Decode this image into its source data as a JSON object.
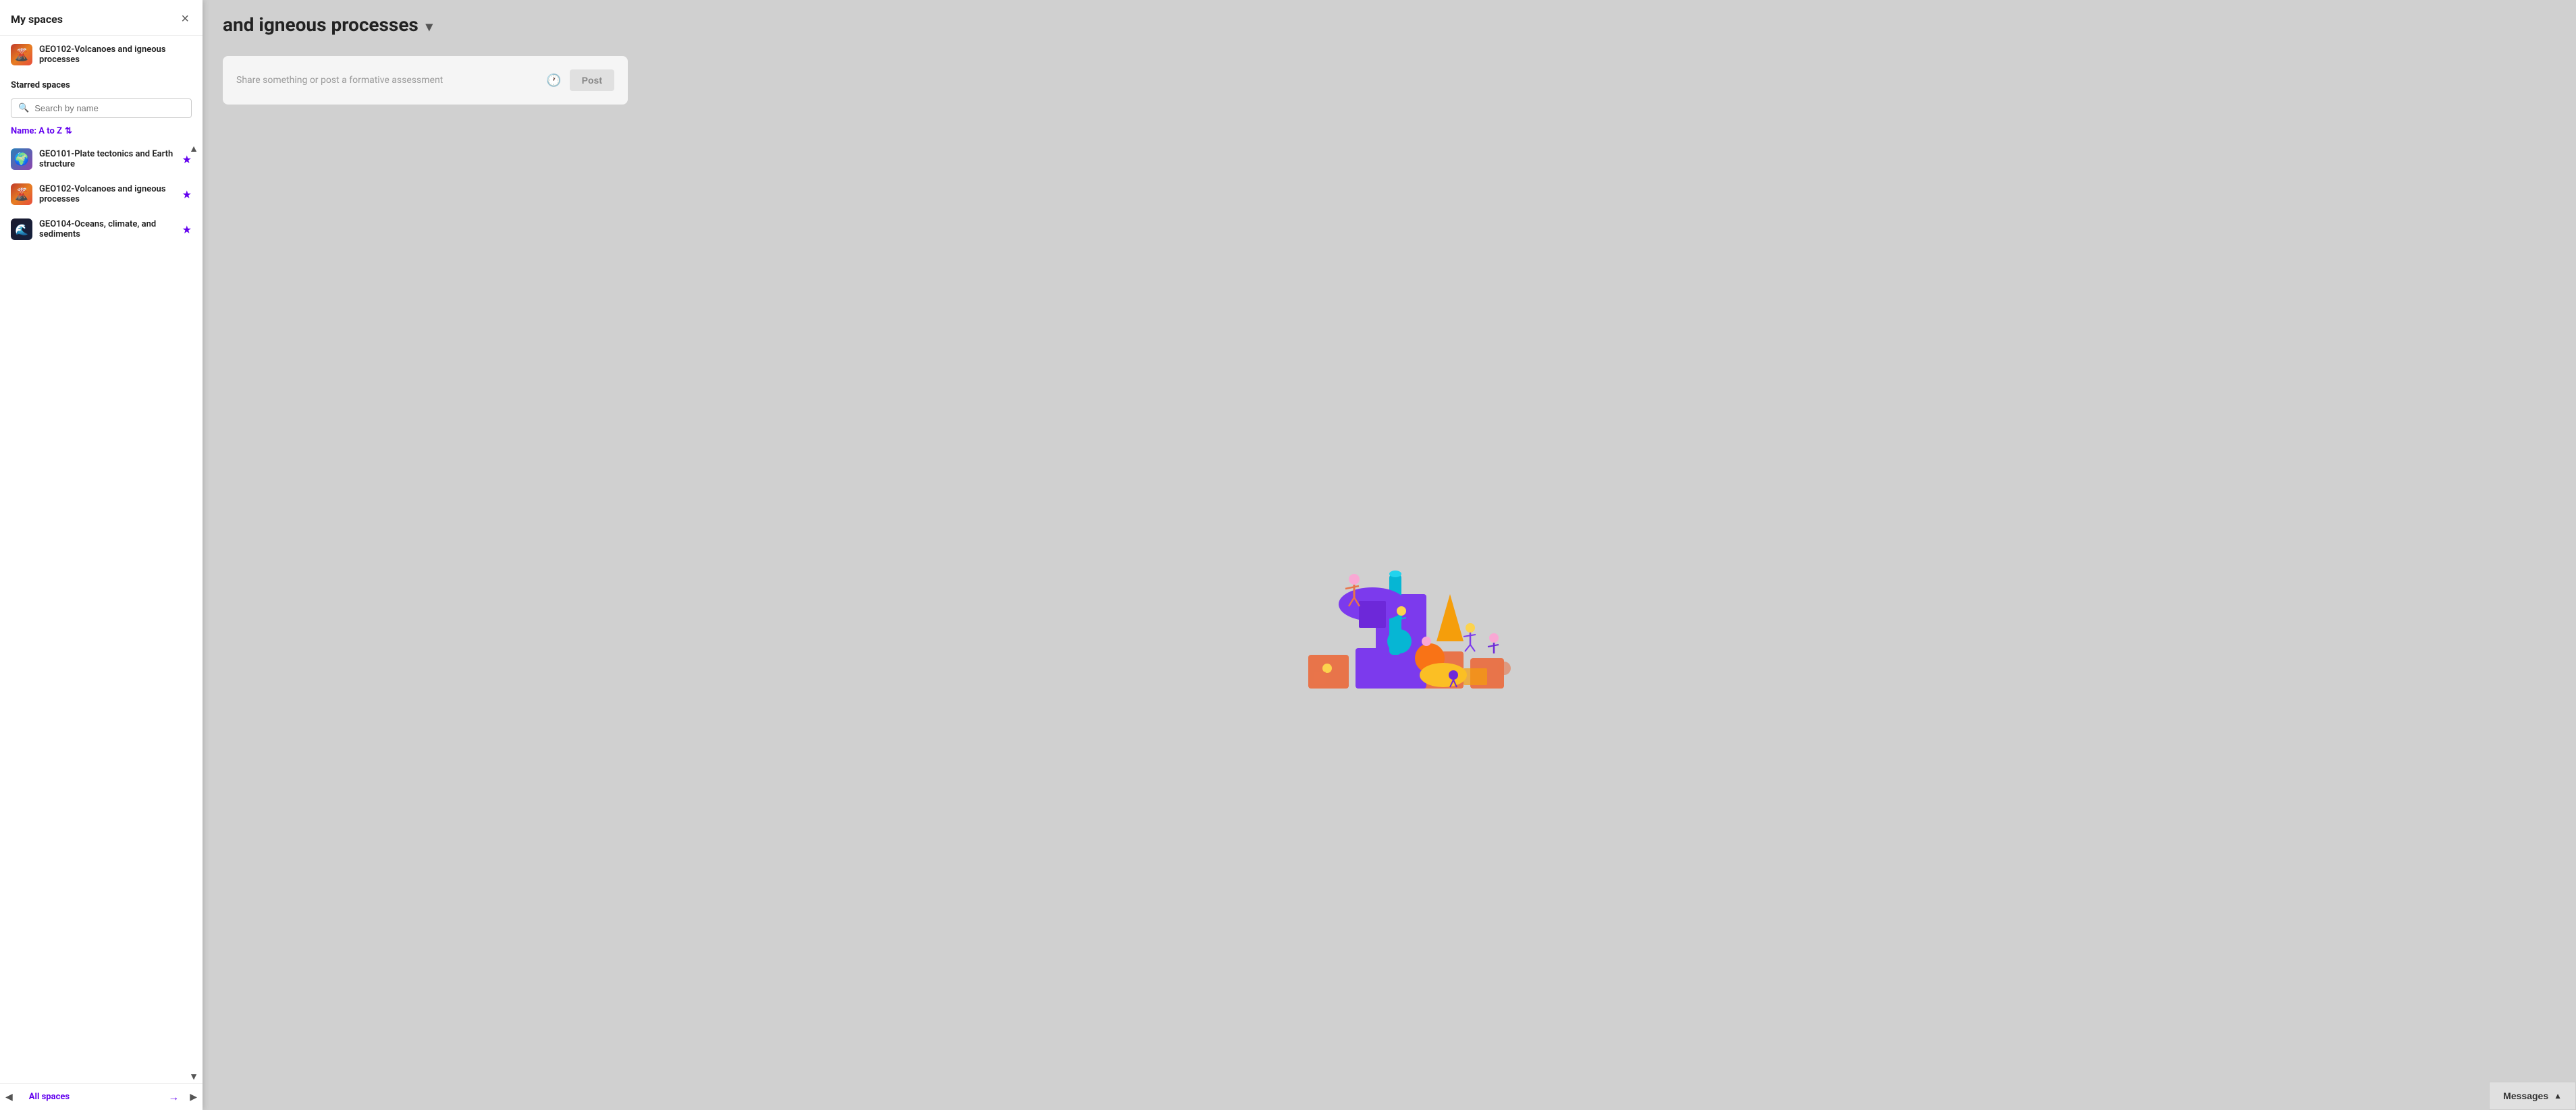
{
  "sidebar": {
    "title": "My spaces",
    "close_label": "×",
    "my_spaces_item": {
      "label": "GEO102-Volcanoes and igneous processes",
      "icon_type": "volcano"
    },
    "starred_spaces_label": "Starred spaces",
    "search_placeholder": "Search by name",
    "sort_label": "Name: A to Z",
    "sort_icon": "⇅",
    "spaces": [
      {
        "label": "GEO101-Plate tectonics and Earth structure",
        "icon_type": "tectonic",
        "starred": true
      },
      {
        "label": "GEO102-Volcanoes and igneous processes",
        "icon_type": "volcano",
        "starred": true
      },
      {
        "label": "GEO104-Oceans, climate, and sediments",
        "icon_type": "ocean",
        "starred": true
      }
    ],
    "all_spaces_label": "All spaces",
    "scroll_up_arrow": "▲",
    "scroll_down_arrow": "▼",
    "scroll_left_arrow": "◀",
    "scroll_right_arrow": "▶",
    "all_spaces_arrow": "→"
  },
  "main": {
    "title": "and igneous processes",
    "dropdown_icon": "▾",
    "post_box": {
      "placeholder": "Share something or post a formative assessment",
      "post_label": "Post"
    }
  },
  "messages_btn": {
    "label": "Messages",
    "chevron": "▲"
  }
}
